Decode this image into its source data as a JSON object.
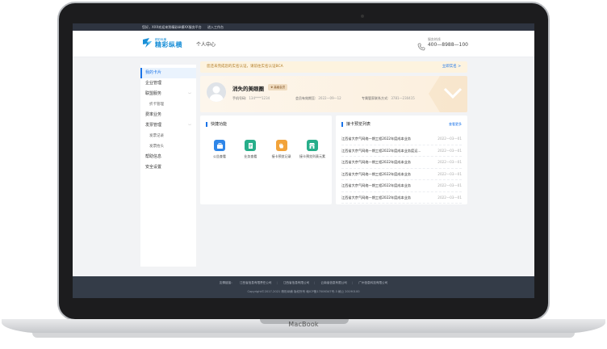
{
  "device": {
    "brand": "MacBook"
  },
  "topbar": {
    "items": [
      "您好，XXX欢迎来到精彩纵横XX服务平台",
      "进入工作台"
    ]
  },
  "header": {
    "logo_sub": "精彩纵横",
    "logo_main": "精彩纵横",
    "nav_center": "个人中心",
    "hotline_label": "服务热线",
    "hotline_number": "400—8988—100"
  },
  "sidebar": {
    "items": [
      {
        "label": "我的卡片",
        "active": true,
        "sub": false
      },
      {
        "label": "企业管理",
        "active": false,
        "sub": false
      },
      {
        "label": "联盟服务",
        "active": false,
        "sub": false,
        "chevron": "﹀"
      },
      {
        "label": "折卡管理",
        "active": false,
        "sub": true
      },
      {
        "label": "费率业务",
        "active": false,
        "sub": false
      },
      {
        "label": "发票管理",
        "active": false,
        "sub": false,
        "chevron": "﹀"
      },
      {
        "label": "发票记录",
        "active": false,
        "sub": true
      },
      {
        "label": "发票抬头",
        "active": false,
        "sub": true
      },
      {
        "label": "帮助信息",
        "active": false,
        "sub": false
      },
      {
        "label": "安全设置",
        "active": false,
        "sub": false
      }
    ]
  },
  "notice": {
    "text": "您还未完成您的实名认证，请前往实名认证BCA",
    "link": "立即实名 >"
  },
  "profile": {
    "name": "消失的美眼圈",
    "badge": "高级会员",
    "phone_label": "手机号码:",
    "phone_value": "134****1234",
    "expire_label": "会员有效期至:",
    "expire_value": "2022—09—12",
    "contact_label": "专属管家联系方式:",
    "contact_value": "3781—230415"
  },
  "quick": {
    "title": "快捷功能",
    "items": [
      {
        "label": "公告查看",
        "color": "#2f86e8",
        "icon": "briefcase-icon"
      },
      {
        "label": "业务查看",
        "color": "#27ae8a",
        "icon": "document-icon"
      },
      {
        "label": "接卡预览记录",
        "color": "#f2a33a",
        "icon": "hand-icon"
      },
      {
        "label": "接卡预览列表元素",
        "color": "#27ae8a",
        "icon": "shop-icon"
      }
    ]
  },
  "list": {
    "title": "接卡预览列表",
    "more": "查看更多",
    "rows": [
      {
        "title": "江西省大京气网络一期工程2022年度成本业务",
        "date": "2022—03—01"
      },
      {
        "title": "江西省大京气网络一期工程2022年度成本业务度运...",
        "date": "2022—03—01"
      },
      {
        "title": "江西省大京气网络一期工程2022年度成本业务",
        "date": "2022—03—01"
      },
      {
        "title": "江西省大京气网络一期工程2022年度成本业务",
        "date": "2022—03—01"
      },
      {
        "title": "江西省大京气网络一期工程2022年度成本业务",
        "date": "2022—03—01"
      },
      {
        "title": "江西省大京气网络一期工程2022年度成本业务",
        "date": "2022—03—01"
      }
    ]
  },
  "footer": {
    "links": [
      "友情链接：",
      "江西省信息有限责任公司",
      "江西省信息有限公司",
      "云南省信息有限公司",
      "广州信息科技有限公司"
    ],
    "copyright": "Copyright©2017-2021 精彩纵横 版权所有 赣ICP备17006347号-3 赣公 20190100"
  },
  "colors": {
    "accent": "#1a73e8",
    "logo": "#1a8fd7",
    "footer_bg": "#343c48",
    "notice_bg": "#fdf3df"
  }
}
